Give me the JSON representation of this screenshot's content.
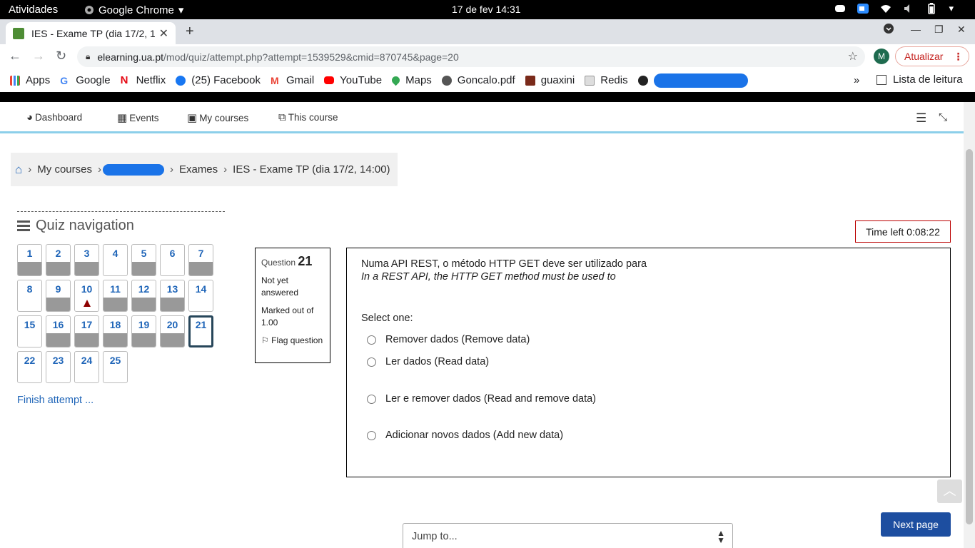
{
  "system_bar": {
    "activities": "Atividades",
    "app": "Google Chrome",
    "clock": "17 de fev  14:31"
  },
  "browser": {
    "tab_title": "IES - Exame TP (dia 17/2, 1",
    "url_host": "elearning.ua.pt",
    "url_path": "/mod/quiz/attempt.php?attempt=1539529&cmid=870745&page=20",
    "profile_initial": "M",
    "update_label": "Atualizar"
  },
  "bookmarks": {
    "items": [
      "Apps",
      "Google",
      "Netflix",
      "(25) Facebook",
      "Gmail",
      "YouTube",
      "Maps",
      "Goncalo.pdf",
      "guaxini",
      "Redis"
    ],
    "more": "»",
    "reading_list": "Lista de leitura"
  },
  "moodle_nav": {
    "dashboard": "Dashboard",
    "events": "Events",
    "my_courses": "My courses",
    "this_course": "This course"
  },
  "breadcrumb": {
    "my_courses": "My courses",
    "exames": "Exames",
    "current": "IES - Exame TP (dia 17/2, 14:00)"
  },
  "quiz_nav": {
    "title": "Quiz navigation",
    "finish": "Finish attempt ...",
    "questions": [
      {
        "n": "1",
        "state": "answered"
      },
      {
        "n": "2",
        "state": "answered"
      },
      {
        "n": "3",
        "state": "answered"
      },
      {
        "n": "4",
        "state": "notyet"
      },
      {
        "n": "5",
        "state": "answered"
      },
      {
        "n": "6",
        "state": "notyet"
      },
      {
        "n": "7",
        "state": "answered"
      },
      {
        "n": "8",
        "state": "notyet"
      },
      {
        "n": "9",
        "state": "answered"
      },
      {
        "n": "10",
        "state": "flagged"
      },
      {
        "n": "11",
        "state": "answered"
      },
      {
        "n": "12",
        "state": "answered"
      },
      {
        "n": "13",
        "state": "answered"
      },
      {
        "n": "14",
        "state": "notyet"
      },
      {
        "n": "15",
        "state": "notyet"
      },
      {
        "n": "16",
        "state": "answered"
      },
      {
        "n": "17",
        "state": "answered"
      },
      {
        "n": "18",
        "state": "answered"
      },
      {
        "n": "19",
        "state": "answered"
      },
      {
        "n": "20",
        "state": "answered"
      },
      {
        "n": "21",
        "state": "current"
      },
      {
        "n": "22",
        "state": "notyet"
      },
      {
        "n": "23",
        "state": "notyet"
      },
      {
        "n": "24",
        "state": "notyet"
      },
      {
        "n": "25",
        "state": "notyet"
      }
    ]
  },
  "question": {
    "label": "Question",
    "number": "21",
    "status": "Not yet answered",
    "marks": "Marked out of 1.00",
    "flag": "Flag question",
    "text_pt": "Numa API REST, o método HTTP GET deve ser utilizado para",
    "text_en": "In a REST API, the HTTP GET method must be used to",
    "select_prompt": "Select one:",
    "options": [
      "Remover dados (Remove data)",
      "Ler dados (Read data)",
      "Ler e remover dados (Read and remove data)",
      "Adicionar novos dados (Add new data)"
    ]
  },
  "timer": "Time left 0:08:22",
  "footer": {
    "next_page": "Next page",
    "jump_to": "Jump to..."
  },
  "colors": {
    "link_blue": "#1f65b8",
    "nav_accent": "#8ccfea",
    "next_button": "#1d4ea0",
    "answered_fill": "#999999",
    "flag": "#8e0000"
  }
}
